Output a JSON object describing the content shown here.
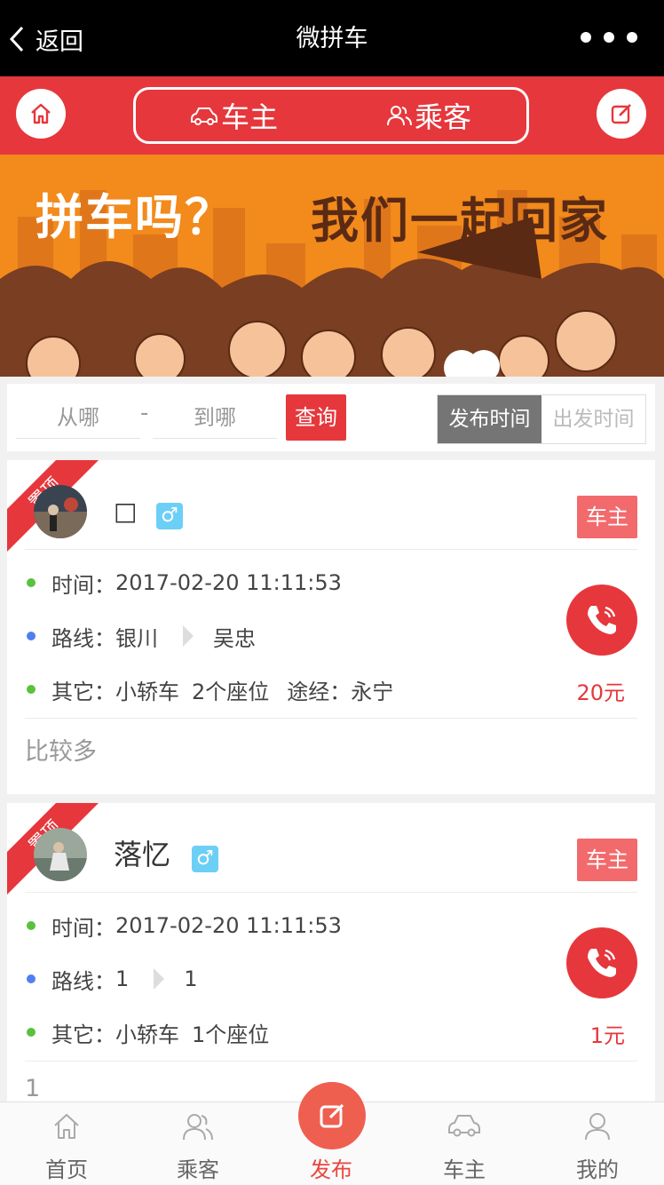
{
  "nav": {
    "back_label": "返回",
    "title": "微拼车"
  },
  "header": {
    "tabs": [
      {
        "label": "车主",
        "icon": "car-icon"
      },
      {
        "label": "乘客",
        "icon": "people-icon"
      }
    ]
  },
  "banner": {
    "headline_left": "拼车吗？",
    "headline_right": "我们一起回家"
  },
  "filter": {
    "from_placeholder": "从哪",
    "separator": "-",
    "to_placeholder": "到哪",
    "query_label": "查询",
    "sort": [
      {
        "label": "发布时间",
        "active": true
      },
      {
        "label": "出发时间",
        "active": false
      }
    ]
  },
  "posts": [
    {
      "ribbon": "置顶",
      "name": "□",
      "gender_symbol": "♂",
      "role": "车主",
      "time_label": "时间：",
      "time": "2017-02-20 11:11:53",
      "route_label": "路线：",
      "from": "银川",
      "to": "吴忠",
      "other_label": "其它：",
      "vehicle": "小轿车",
      "seats": "2个座位",
      "via_label": "途经：",
      "via": "永宁",
      "price": "20元",
      "note": "比较多"
    },
    {
      "ribbon": "置顶",
      "name": "落忆",
      "gender_symbol": "♂",
      "role": "车主",
      "time_label": "时间：",
      "time": "2017-02-20 11:11:53",
      "route_label": "路线：",
      "from": "1",
      "to": "1",
      "other_label": "其它：",
      "vehicle": "小轿车",
      "seats": "1个座位",
      "price": "1元",
      "note": "1"
    }
  ],
  "tabbar": [
    {
      "label": "首页",
      "icon": "home-icon",
      "active": false
    },
    {
      "label": "乘客",
      "icon": "people-icon",
      "active": false
    },
    {
      "label": "发布",
      "icon": "edit-icon",
      "active": true
    },
    {
      "label": "车主",
      "icon": "car-icon",
      "active": false
    },
    {
      "label": "我的",
      "icon": "user-icon",
      "active": false
    }
  ],
  "colors": {
    "primary_red": "#e6373c",
    "banner_orange": "#f28a1c",
    "gender_blue": "#6ccff6",
    "publish_orange": "#ee5f50"
  }
}
